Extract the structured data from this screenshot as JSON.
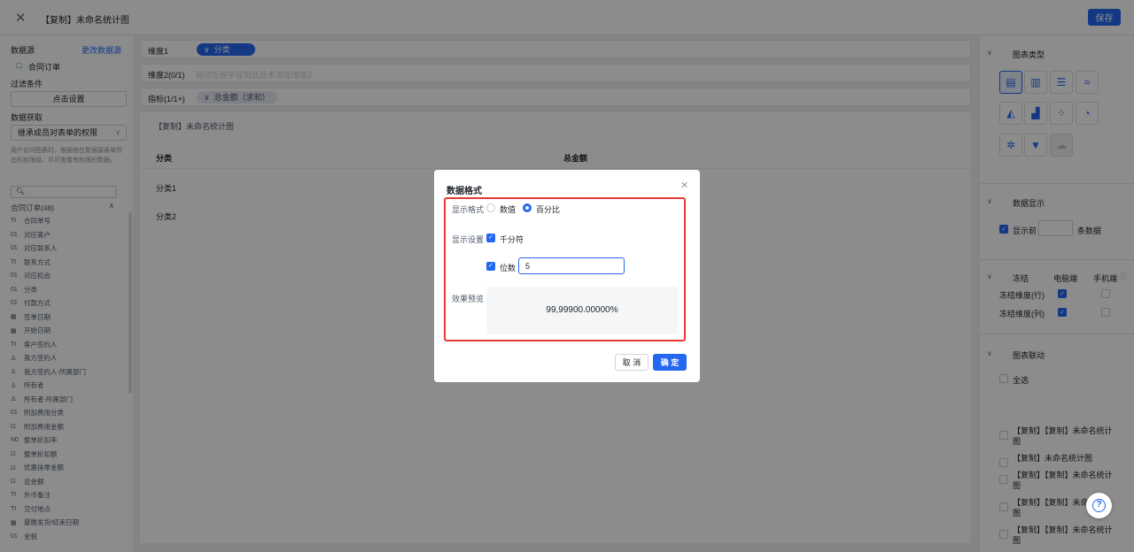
{
  "header": {
    "title": "【复制】未命名统计图",
    "save_label": "保存"
  },
  "left": {
    "datasource_label": "数据源",
    "change_source": "更改数据源",
    "source_name": "合同订单",
    "filter_label": "过滤条件",
    "filter_btn": "点击设置",
    "fetch_label": "数据获取",
    "fetch_value": "继承成员对表单的权限",
    "hint": "用户访问图表时，根据他在数据源表单所在的权限组，尽可查看有权限的数据。",
    "group_title": "合同订单(48)",
    "fields": [
      {
        "icon": "Tt",
        "label": "合同单号"
      },
      {
        "icon": "01",
        "label": "对应客户"
      },
      {
        "icon": "01",
        "label": "对应联系人"
      },
      {
        "icon": "Tt",
        "label": "联系方式"
      },
      {
        "icon": "01",
        "label": "对应机会"
      },
      {
        "icon": "01",
        "label": "分类"
      },
      {
        "icon": "01",
        "label": "付款方式"
      },
      {
        "icon": "▦",
        "label": "签单日期"
      },
      {
        "icon": "▦",
        "label": "开始日期"
      },
      {
        "icon": "Tt",
        "label": "客户签约人"
      },
      {
        "icon": "♙",
        "label": "我方签约人"
      },
      {
        "icon": "♙",
        "label": "我方签约人-所属部门"
      },
      {
        "icon": "♙",
        "label": "所有者"
      },
      {
        "icon": "♙",
        "label": "所有者-所属部门"
      },
      {
        "icon": "01",
        "label": "附加费用分类"
      },
      {
        "icon": "⊡",
        "label": "附加费用金额"
      },
      {
        "icon": "N0",
        "label": "整单折扣率"
      },
      {
        "icon": "⊡",
        "label": "整单折扣额"
      },
      {
        "icon": "⊡",
        "label": "优惠抹零金额"
      },
      {
        "icon": "⊡",
        "label": "总金额"
      },
      {
        "icon": "Tt",
        "label": "外币备注"
      },
      {
        "icon": "Tt",
        "label": "交付地点"
      },
      {
        "icon": "▦",
        "label": "最晚发货/结束日期"
      },
      {
        "icon": "01",
        "label": "金税"
      }
    ]
  },
  "center": {
    "dim1_label": "维度1",
    "dim1_pill": "分类",
    "dim2_label": "维度2(0/1)",
    "dim2_hint": "拖动左侧字段到此处来添加维度2",
    "metric_label": "指标(1/1+)",
    "metric_pill": "总金额（求和）",
    "chart_title": "【复制】未命名统计图",
    "col1": "分类",
    "col2": "总金额",
    "rows": [
      "分类1",
      "分类2"
    ]
  },
  "right": {
    "chart_type_title": "图表类型",
    "display_title": "数据显示",
    "show_first": "显示前",
    "rows_unit": "条数据",
    "freeze_title": "冻结",
    "pc": "电脑端",
    "mobile": "手机端",
    "freeze_row": "冻结维度(行)",
    "freeze_col": "冻结维度(列)",
    "link_title": "图表联动",
    "select_all": "全选",
    "links": [
      {
        "l1": "【复制】【复制】未命名统计",
        "l2": "图"
      },
      {
        "l1": "【复制】未命名统计图",
        "l2": ""
      },
      {
        "l1": "【复制】【复制】未命名统计",
        "l2": "图"
      },
      {
        "l1": "【复制】【复制】未命名统计",
        "l2": "图"
      },
      {
        "l1": "【复制】【复制】未命名统计",
        "l2": "图"
      }
    ]
  },
  "dialog": {
    "title": "数据格式",
    "format_label": "显示格式",
    "opt_number": "数值",
    "opt_percent": "百分比",
    "setting_label": "显示设置",
    "thousands": "千分符",
    "digits_label": "位数",
    "digits_value": "5",
    "preview_label": "效果预览",
    "preview_value": "99,99900.00000%",
    "cancel": "取 消",
    "ok": "确 定"
  },
  "colors": {
    "accent": "#2468f2",
    "highlight": "#e53935"
  }
}
